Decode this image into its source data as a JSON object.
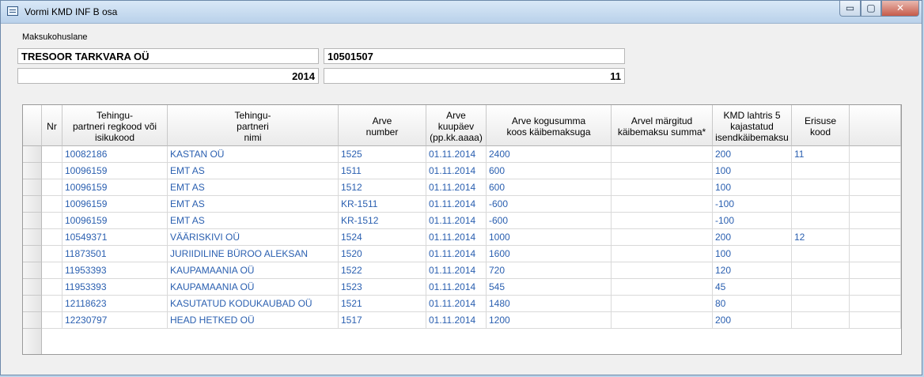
{
  "window": {
    "title": "Vormi KMD INF B osa"
  },
  "form": {
    "taxpayer_label": "Maksukohuslane",
    "company_name": "TRESOOR TARKVARA OÜ",
    "reg_code": "10501507",
    "year": "2014",
    "month": "11"
  },
  "table": {
    "columns": [
      {
        "key": "nr",
        "label": "Nr"
      },
      {
        "key": "regkood",
        "label": "Tehingu-\npartneri regkood või\nisikukood"
      },
      {
        "key": "nimi",
        "label": "Tehingu-\npartneri\nnimi"
      },
      {
        "key": "arve_nr",
        "label": "Arve\nnumber"
      },
      {
        "key": "kuupaev",
        "label": "Arve\nkuupäev\n(pp.kk.aaaa)"
      },
      {
        "key": "kogusumma",
        "label": "Arve kogusumma\nkoos käibemaksuga"
      },
      {
        "key": "km_summa",
        "label": "Arvel märgitud\nkäibemaksu summa*"
      },
      {
        "key": "kmd_lahter5",
        "label": "KMD lahtris 5\nkajastatud\nisendkäibemaksu"
      },
      {
        "key": "erisus",
        "label": "Erisuse\nkood"
      }
    ],
    "rows": [
      {
        "nr": "",
        "regkood": "10082186",
        "nimi": "KASTAN OÜ",
        "arve_nr": "1525",
        "kuupaev": "01.11.2014",
        "kogusumma": "2400",
        "km_summa": "",
        "kmd_lahter5": "200",
        "erisus": "11"
      },
      {
        "nr": "",
        "regkood": "10096159",
        "nimi": "EMT AS",
        "arve_nr": "1511",
        "kuupaev": "01.11.2014",
        "kogusumma": "600",
        "km_summa": "",
        "kmd_lahter5": "100",
        "erisus": ""
      },
      {
        "nr": "",
        "regkood": "10096159",
        "nimi": "EMT AS",
        "arve_nr": "1512",
        "kuupaev": "01.11.2014",
        "kogusumma": "600",
        "km_summa": "",
        "kmd_lahter5": "100",
        "erisus": ""
      },
      {
        "nr": "",
        "regkood": "10096159",
        "nimi": "EMT AS",
        "arve_nr": "KR-1511",
        "kuupaev": "01.11.2014",
        "kogusumma": "-600",
        "km_summa": "",
        "kmd_lahter5": "-100",
        "erisus": ""
      },
      {
        "nr": "",
        "regkood": "10096159",
        "nimi": "EMT AS",
        "arve_nr": "KR-1512",
        "kuupaev": "01.11.2014",
        "kogusumma": "-600",
        "km_summa": "",
        "kmd_lahter5": "-100",
        "erisus": ""
      },
      {
        "nr": "",
        "regkood": "10549371",
        "nimi": "VÄÄRISKIVI OÜ",
        "arve_nr": "1524",
        "kuupaev": "01.11.2014",
        "kogusumma": "1000",
        "km_summa": "",
        "kmd_lahter5": "200",
        "erisus": "12"
      },
      {
        "nr": "",
        "regkood": "11873501",
        "nimi": "JURIIDILINE BÜROO ALEKSAN",
        "arve_nr": "1520",
        "kuupaev": "01.11.2014",
        "kogusumma": "1600",
        "km_summa": "",
        "kmd_lahter5": "100",
        "erisus": ""
      },
      {
        "nr": "",
        "regkood": "11953393",
        "nimi": "KAUPAMAANIA OÜ",
        "arve_nr": "1522",
        "kuupaev": "01.11.2014",
        "kogusumma": "720",
        "km_summa": "",
        "kmd_lahter5": "120",
        "erisus": ""
      },
      {
        "nr": "",
        "regkood": "11953393",
        "nimi": "KAUPAMAANIA OÜ",
        "arve_nr": "1523",
        "kuupaev": "01.11.2014",
        "kogusumma": "545",
        "km_summa": "",
        "kmd_lahter5": "45",
        "erisus": ""
      },
      {
        "nr": "",
        "regkood": "12118623",
        "nimi": "KASUTATUD KODUKAUBAD OÜ",
        "arve_nr": "1521",
        "kuupaev": "01.11.2014",
        "kogusumma": "1480",
        "km_summa": "",
        "kmd_lahter5": "80",
        "erisus": ""
      },
      {
        "nr": "",
        "regkood": "12230797",
        "nimi": "HEAD HETKED OÜ",
        "arve_nr": "1517",
        "kuupaev": "01.11.2014",
        "kogusumma": "1200",
        "km_summa": "",
        "kmd_lahter5": "200",
        "erisus": ""
      }
    ]
  },
  "icons": {
    "window_icon": "form-window-icon",
    "minimize": "minimize-icon",
    "maximize": "maximize-icon",
    "close": "close-icon"
  },
  "colors": {
    "cell_text": "#2a5fb0",
    "titlebar": "#c9dcf0",
    "close_button": "#c65b4a"
  }
}
